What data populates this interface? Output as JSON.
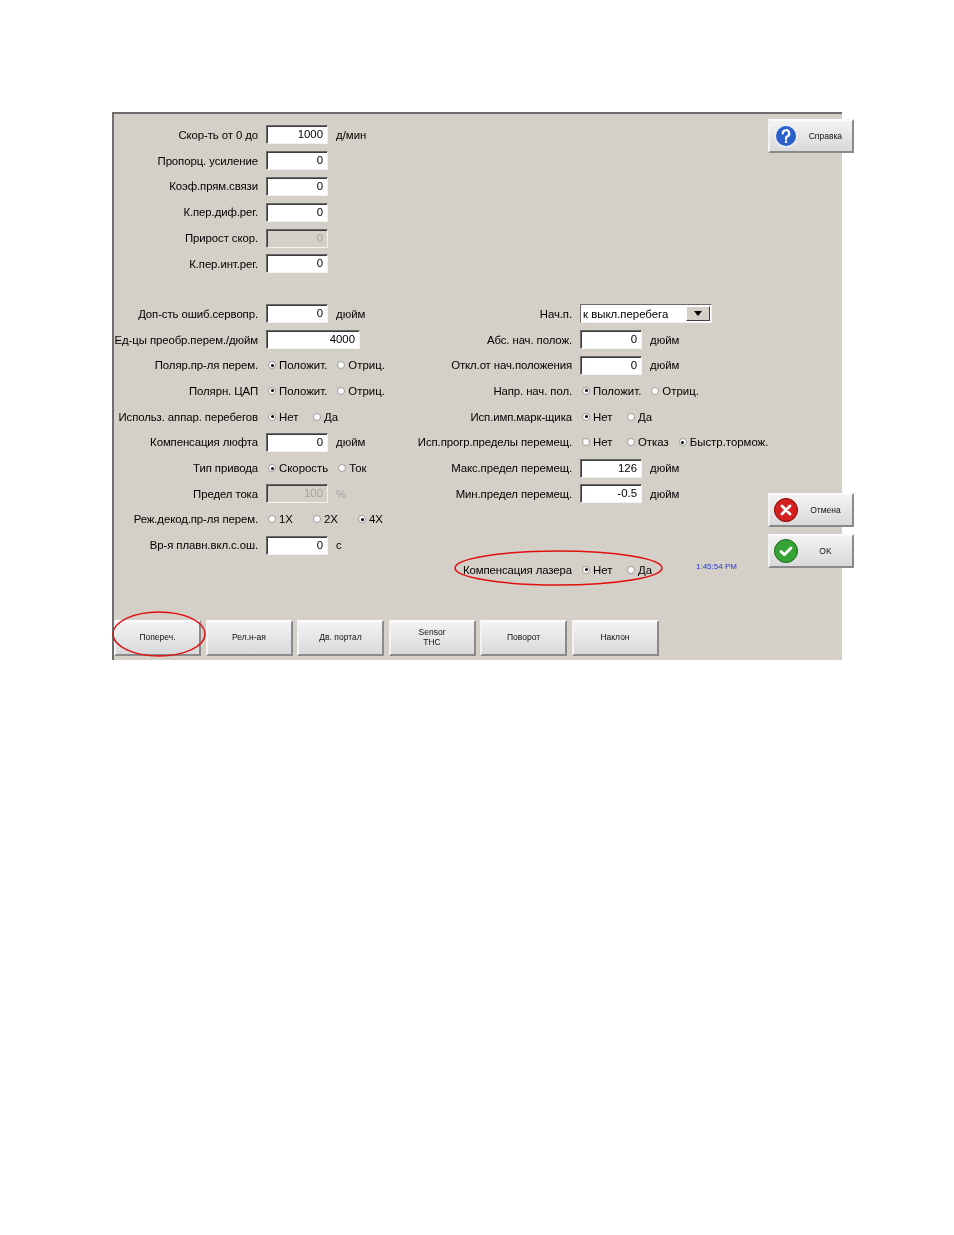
{
  "help_button": {
    "label": "Справка"
  },
  "fields_top": [
    {
      "kind": "input",
      "label": "Скор-ть от 0 до",
      "value": "1000",
      "unit": "д/мин",
      "disabled": false
    },
    {
      "kind": "input",
      "label": "Пропорц. усиление",
      "value": "0",
      "disabled": false
    },
    {
      "kind": "input",
      "label": "Коэф.прям.связи",
      "value": "0",
      "disabled": false
    },
    {
      "kind": "input",
      "label": "К.пер.диф.рег.",
      "value": "0",
      "disabled": false
    },
    {
      "kind": "input",
      "label": "Прирост скор.",
      "value": "0",
      "disabled": true
    },
    {
      "kind": "input",
      "label": "К.пер.инт.рег.",
      "value": "0",
      "disabled": false
    }
  ],
  "fields_left": [
    {
      "kind": "input",
      "label": "Доп-сть ошиб.сервопр.",
      "value": "0",
      "unit": "дюйм",
      "disabled": false
    },
    {
      "kind": "input",
      "label": "Ед-цы преобр.перем./дюйм",
      "value": "4000",
      "disabled": false
    },
    {
      "kind": "radio",
      "label": "Поляр.пр-ля перем.",
      "options": [
        {
          "label": "Положит.",
          "selected": true
        },
        {
          "label": "Отриц.",
          "selected": false
        }
      ]
    },
    {
      "kind": "radio",
      "label": "Полярн. ЦАП",
      "options": [
        {
          "label": "Положит.",
          "selected": true
        },
        {
          "label": "Отриц.",
          "selected": false
        }
      ]
    },
    {
      "kind": "radio",
      "label": "Использ. аппар. перебегов",
      "options": [
        {
          "label": "Нет",
          "selected": true
        },
        {
          "label": "Да",
          "selected": false
        }
      ]
    },
    {
      "kind": "input",
      "label": "Компенсация люфта",
      "value": "0",
      "unit": "дюйм",
      "disabled": false
    },
    {
      "kind": "radio",
      "label": "Тип привода",
      "options": [
        {
          "label": "Скорость",
          "selected": true
        },
        {
          "label": "Ток",
          "selected": false
        }
      ]
    },
    {
      "kind": "input",
      "label": "Предел тока",
      "value": "100",
      "unit": "%",
      "disabled": true
    },
    {
      "kind": "radio",
      "label": "Реж.декод.пр-ля перем.",
      "options": [
        {
          "label": "1X",
          "selected": false
        },
        {
          "label": "2X",
          "selected": false
        },
        {
          "label": "4X",
          "selected": true
        }
      ]
    },
    {
      "kind": "input",
      "label": "Вр-я плавн.вкл.с.ош.",
      "value": "0",
      "unit": "с",
      "disabled": false
    }
  ],
  "fields_right": [
    {
      "kind": "dropdown",
      "label": "Нач.п.",
      "value": "к выкл.перебега"
    },
    {
      "kind": "input",
      "label": "Абс. нач. полож.",
      "value": "0",
      "unit": "дюйм"
    },
    {
      "kind": "input",
      "label": "Откл.от нач.положения",
      "value": "0",
      "unit": "дюйм"
    },
    {
      "kind": "radio",
      "label": "Напр. нач. пол.",
      "options": [
        {
          "label": "Положит.",
          "selected": true
        },
        {
          "label": "Отриц.",
          "selected": false
        }
      ]
    },
    {
      "kind": "radio",
      "label": "Исп.имп.марк-щика",
      "options": [
        {
          "label": "Нет",
          "selected": true
        },
        {
          "label": "Да",
          "selected": false
        }
      ]
    },
    {
      "kind": "radio",
      "label": "Исп.прогр.пределы перемещ.",
      "options": [
        {
          "label": "Нет",
          "selected": false
        },
        {
          "label": "Отказ",
          "selected": false
        },
        {
          "label": "Быстр.тормож.",
          "selected": true
        }
      ]
    },
    {
      "kind": "input",
      "label": "Макс.предел перемещ.",
      "value": "126",
      "unit": "дюйм"
    },
    {
      "kind": "input",
      "label": "Мин.предел перемещ.",
      "value": "-0.5",
      "unit": "дюйм"
    }
  ],
  "laser_compensation": {
    "label": "Компенсация лазера",
    "options": [
      {
        "label": "Нет",
        "selected": true
      },
      {
        "label": "Да",
        "selected": false
      }
    ],
    "highlighted": true
  },
  "time": "1:45:54 PM",
  "action_buttons": [
    {
      "kind": "cancel",
      "label": "Отмена"
    },
    {
      "kind": "ok",
      "label": "OK"
    }
  ],
  "tabs": [
    {
      "label": "Попереч.",
      "highlighted": true
    },
    {
      "label": "Рел.н-ая",
      "highlighted": false
    },
    {
      "label": "Дв. портал",
      "highlighted": false
    },
    {
      "label": "Sensor\nTHC",
      "highlighted": false
    },
    {
      "label": "Поворот",
      "highlighted": false
    },
    {
      "label": "Наклон",
      "highlighted": false
    }
  ]
}
